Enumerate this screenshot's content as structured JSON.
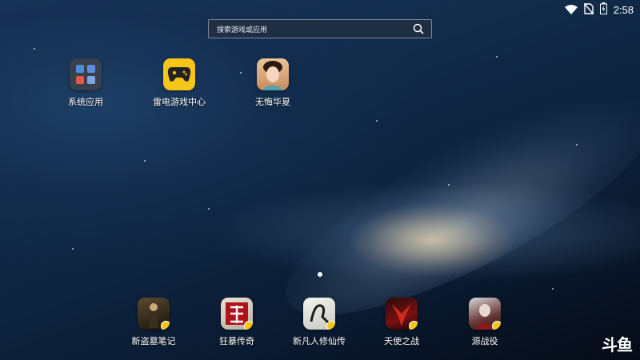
{
  "status_bar": {
    "time": "2:58",
    "icons": [
      "wifi-icon",
      "no-sim-icon",
      "battery-icon"
    ]
  },
  "search": {
    "placeholder": "搜索游戏或应用"
  },
  "desktop_apps": [
    {
      "label": "系统应用",
      "icon": "folder-icon"
    },
    {
      "label": "雷电游戏中心",
      "icon": "gamepad-icon"
    },
    {
      "label": "无悔华夏",
      "icon": "portrait-icon"
    }
  ],
  "dock_apps": [
    {
      "label": "新盗墓笔记",
      "icon": "game-icon"
    },
    {
      "label": "狂暴传奇",
      "icon": "game-icon"
    },
    {
      "label": "新凡人修仙传",
      "icon": "game-icon"
    },
    {
      "label": "天使之战",
      "icon": "game-icon"
    },
    {
      "label": "源战役",
      "icon": "game-icon"
    }
  ],
  "watermark": "斗鱼",
  "colors": {
    "accent_yellow": "#f5c518",
    "background_dark": "#0f2744"
  }
}
